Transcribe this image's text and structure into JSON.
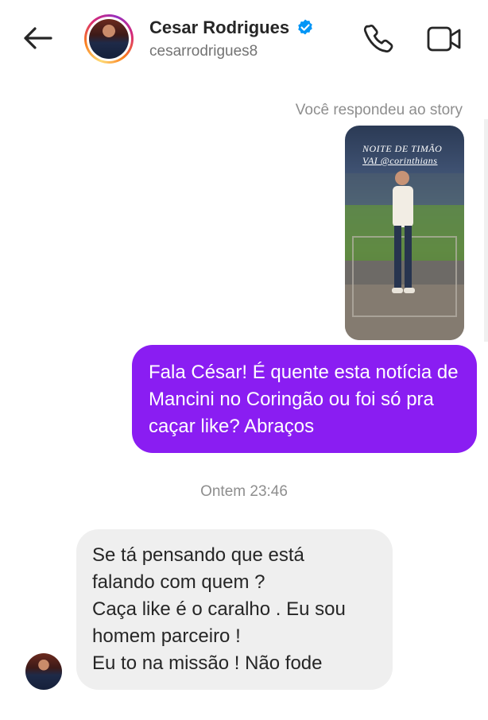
{
  "header": {
    "back_icon": "arrow-left-icon",
    "display_name": "Cesar Rodrigues",
    "username": "cesarrodrigues8",
    "verified_icon": "verified-badge-icon",
    "call_icon": "phone-icon",
    "video_icon": "video-camera-icon"
  },
  "story_reply": {
    "label": "Você respondeu ao story",
    "story_text_line1": "NOITE DE TIMÃO",
    "story_text_line2": "VAI @corinthians"
  },
  "messages": {
    "sent": {
      "text": "Fala César! É quente esta notícia de Mancini no Coringão ou foi só pra caçar like? Abraços"
    },
    "timestamp": "Ontem 23:46",
    "received": {
      "lines": [
        "Se tá pensando que está",
        "falando com quem ?",
        "Caça like é o caralho . Eu sou",
        "homem parceiro !",
        "Eu to na missão ! Não fode"
      ]
    }
  },
  "colors": {
    "sent_bubble": "#8a1df2",
    "received_bubble": "#efefef",
    "verified": "#0095f6",
    "muted_text": "#8e8e8e"
  }
}
